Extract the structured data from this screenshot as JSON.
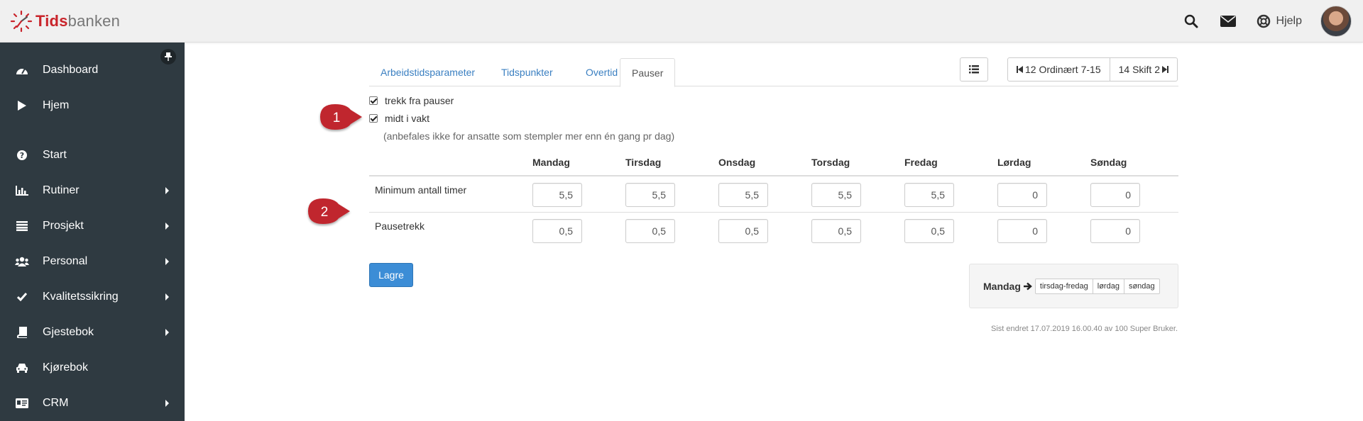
{
  "brand": {
    "part1": "Tids",
    "part2": "banken",
    "accent": "#c9242b"
  },
  "header": {
    "help_label": "Hjelp"
  },
  "sidebar": {
    "items": [
      {
        "label": "Dashboard",
        "icon": "dashboard-icon"
      },
      {
        "label": "Hjem",
        "icon": "play-icon"
      },
      {
        "label": "Start",
        "icon": "question-circle-icon"
      },
      {
        "label": "Rutiner",
        "icon": "bar-chart-icon"
      },
      {
        "label": "Prosjekt",
        "icon": "list-icon"
      },
      {
        "label": "Personal",
        "icon": "users-icon"
      },
      {
        "label": "Kvalitetssikring",
        "icon": "check-icon"
      },
      {
        "label": "Gjestebok",
        "icon": "book-icon"
      },
      {
        "label": "Kjørebok",
        "icon": "car-icon"
      },
      {
        "label": "CRM",
        "icon": "id-card-icon"
      }
    ]
  },
  "tabs": [
    {
      "label": "Arbeidstidsparameter"
    },
    {
      "label": "Tidspunkter"
    },
    {
      "label": "Overtid"
    },
    {
      "label": "Pauser"
    }
  ],
  "shift_nav": {
    "prev": "12 Ordinært 7-15",
    "next": "14 Skift 2"
  },
  "options": {
    "deduct_breaks": "trekk fra pauser",
    "mid_shift": "midt i vakt",
    "hint": "(anbefales ikke for ansatte som stempler mer enn én gang pr dag)"
  },
  "callouts": {
    "one": "1",
    "two": "2",
    "color": "#c0262d"
  },
  "table": {
    "days": [
      "Mandag",
      "Tirsdag",
      "Onsdag",
      "Torsdag",
      "Fredag",
      "Lørdag",
      "Søndag"
    ],
    "rows": [
      {
        "label": "Minimum antall timer",
        "values": [
          "5,5",
          "5,5",
          "5,5",
          "5,5",
          "5,5",
          "0",
          "0"
        ]
      },
      {
        "label": "Pausetrekk",
        "values": [
          "0,5",
          "0,5",
          "0,5",
          "0,5",
          "0,5",
          "0",
          "0"
        ]
      }
    ]
  },
  "save_label": "Lagre",
  "copy_legend": {
    "label": "Mandag",
    "chips": [
      "tirsdag-fredag",
      "lørdag",
      "søndag"
    ]
  },
  "footer": "Sist endret 17.07.2019 16.00.40 av 100 Super Bruker."
}
